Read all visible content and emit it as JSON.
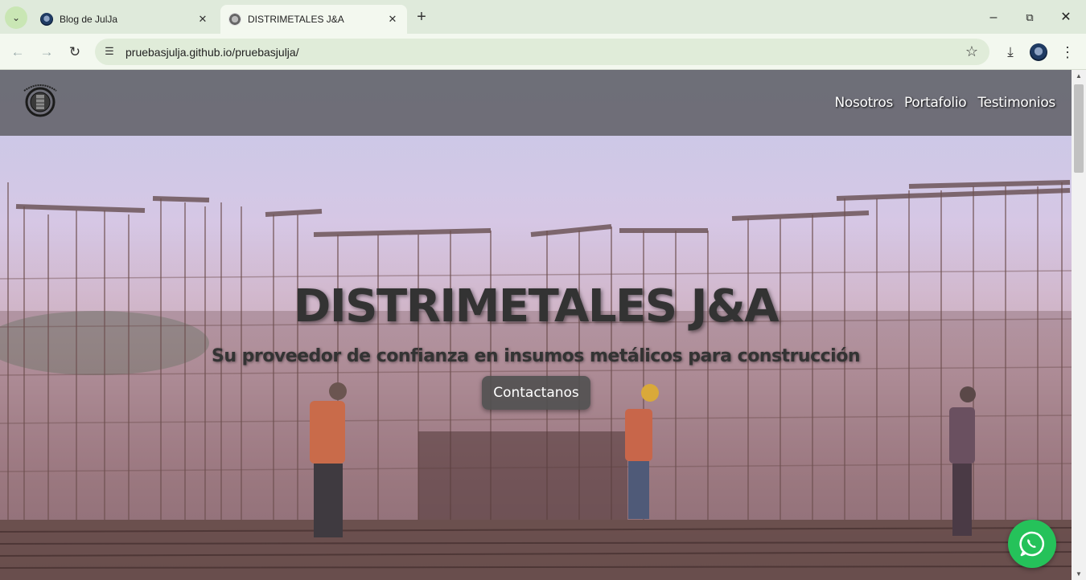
{
  "browser": {
    "tabs": [
      {
        "title": "Blog de JulJa",
        "active": false
      },
      {
        "title": "DISTRIMETALES J&A",
        "active": true
      }
    ],
    "new_tab_symbol": "+",
    "url": "pruebasjulja.github.io/pruebasjulja/",
    "icons": {
      "tab_menu": "chevron-down-icon",
      "back": "back-arrow-icon",
      "forward": "forward-arrow-icon",
      "reload": "reload-icon",
      "site_info": "tune-icon",
      "bookmark": "star-icon",
      "download": "download-icon",
      "menu": "kebab-menu-icon",
      "minimize": "minimize-icon",
      "restore": "restore-icon",
      "close": "close-icon"
    }
  },
  "site": {
    "nav": {
      "links": [
        "Nosotros",
        "Portafolio",
        "Testimonios"
      ]
    },
    "hero": {
      "title": "DISTRIMETALES J&A",
      "subtitle": "Su proveedor de confianza en insumos metálicos para construcción",
      "cta_label": "Contactanos"
    },
    "floating": {
      "icon": "whatsapp-icon"
    }
  },
  "colors": {
    "chrome_bg": "#dfeadb",
    "omnibox_bg": "#e0ecd9",
    "navbar_overlay": "#5a5a5f",
    "cta_bg": "#505050",
    "whatsapp_green": "#25c25a"
  }
}
